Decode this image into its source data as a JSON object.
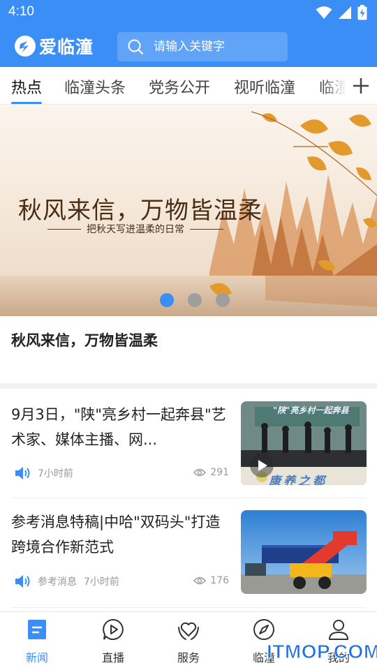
{
  "status_bar": {
    "time": "4:10"
  },
  "app": {
    "name": "爱临潼",
    "brand_color": "#3a8ef6"
  },
  "search": {
    "placeholder": "请输入关键字"
  },
  "tabs": [
    {
      "label": "热点",
      "active": true
    },
    {
      "label": "临潼头条"
    },
    {
      "label": "党务公开"
    },
    {
      "label": "视听临潼"
    },
    {
      "label": "临潼"
    }
  ],
  "banner": {
    "title": "秋风来信，万物皆温柔",
    "subtitle": "把秋天写进温柔的日常",
    "caption": "秋风来信，万物皆温柔",
    "slide_count": 3,
    "active_slide": 1
  },
  "news": [
    {
      "title": "9月3日，\"陕\"亮乡村一起奔县\"艺术家、媒体主播、网...",
      "source": "",
      "time": "7小时前",
      "views": "291",
      "thumb_text": "\"陕\"亮乡村一起奔县",
      "thumb_footer": "康养之都",
      "has_video": true
    },
    {
      "title": "参考消息特稿|中哈\"双码头\"打造跨境合作新范式",
      "source": "参考消息",
      "time": "7小时前",
      "views": "176",
      "has_video": false
    }
  ],
  "bottom_nav": [
    {
      "label": "新闻",
      "icon": "news-icon",
      "active": true
    },
    {
      "label": "直播",
      "icon": "live-play-icon"
    },
    {
      "label": "服务",
      "icon": "service-heart-icon"
    },
    {
      "label": "临潼",
      "icon": "compass-icon"
    },
    {
      "label": "我的",
      "icon": "profile-icon"
    }
  ],
  "watermark": "ITMOP.COM"
}
